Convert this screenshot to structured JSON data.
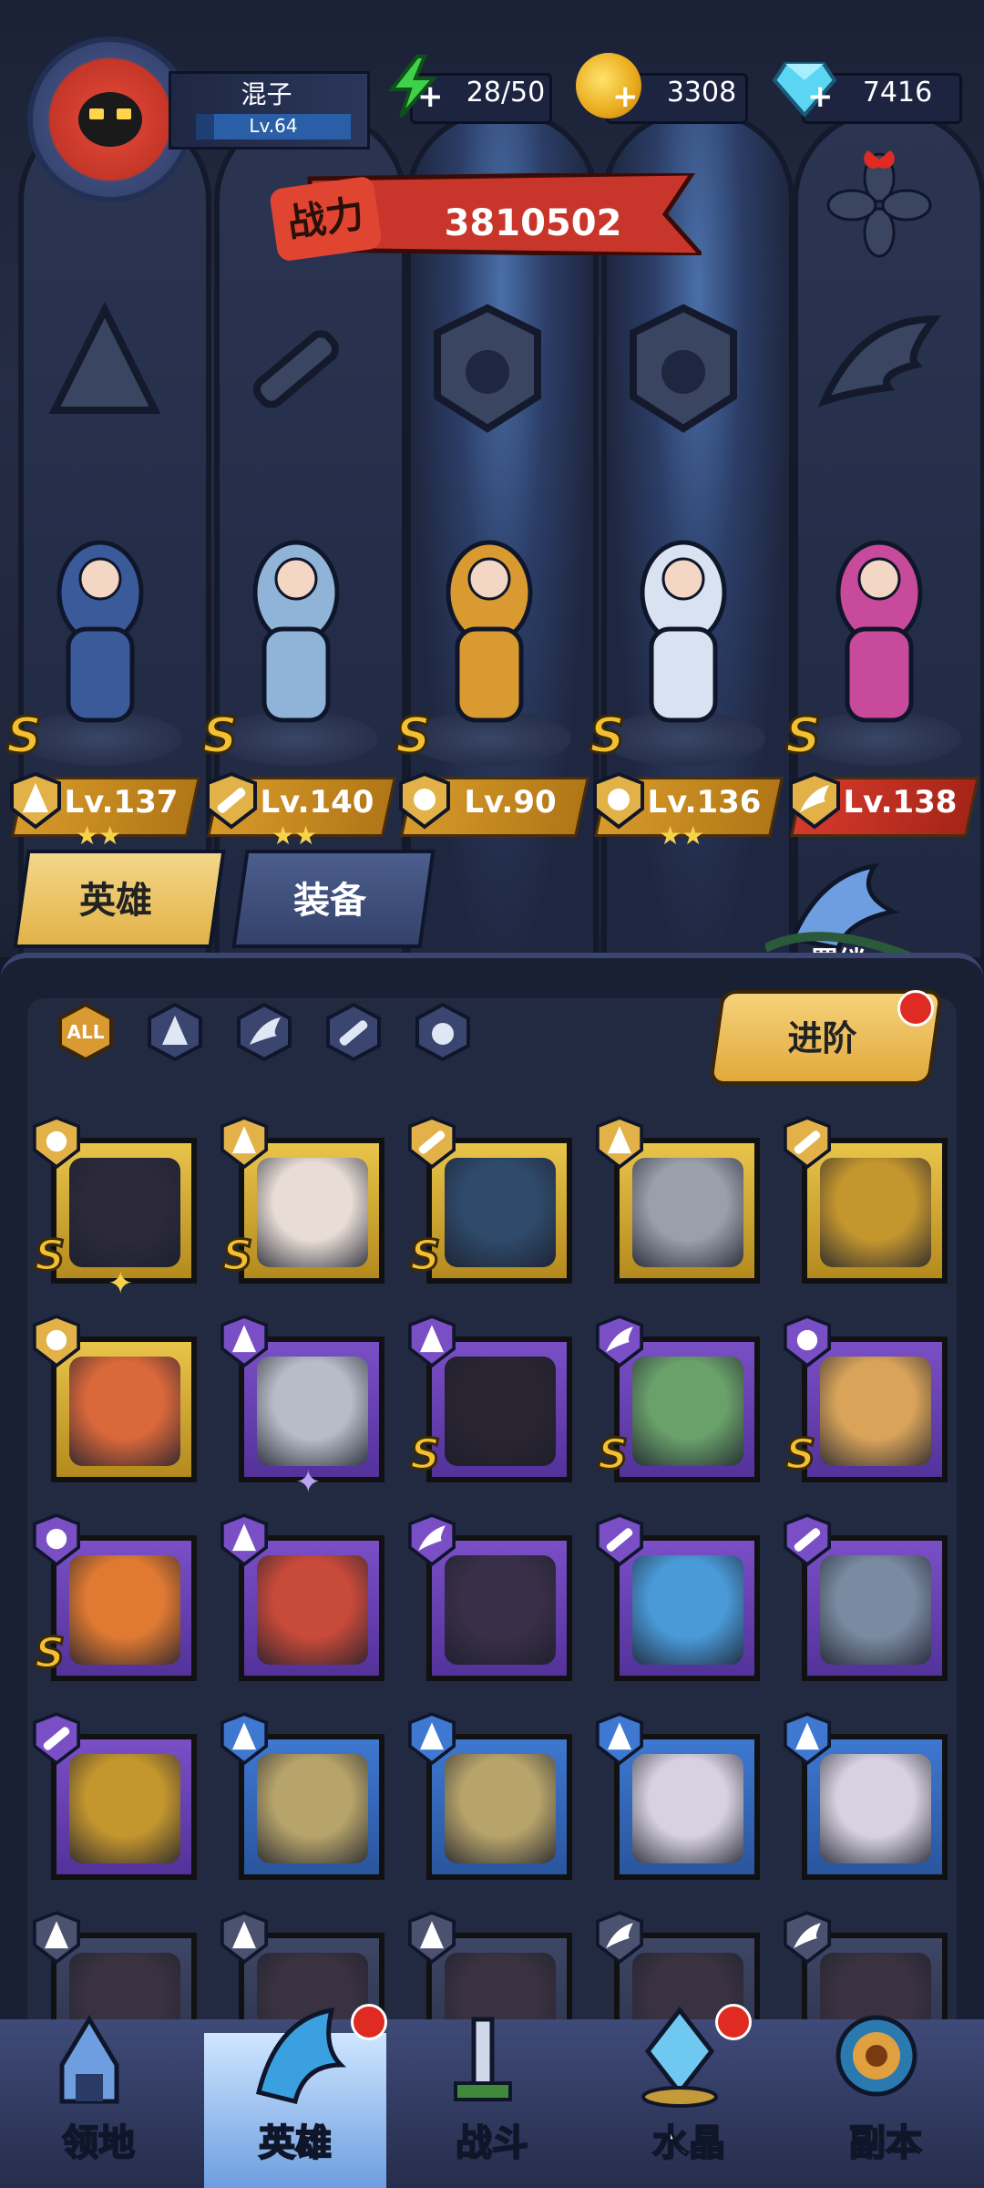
{
  "player": {
    "name": "混子",
    "level": "Lv.64",
    "xp_fraction": 0.12
  },
  "resources": {
    "energy": {
      "icon": "lightning-icon",
      "value": "28/50"
    },
    "gold": {
      "icon": "gold-coin-icon",
      "value": "3308"
    },
    "diamond": {
      "icon": "diamond-icon",
      "value": "7416"
    }
  },
  "power": {
    "label": "战力",
    "value": "3810502"
  },
  "lineup": [
    {
      "name": "card-magician",
      "class": "mage",
      "rank": "S",
      "level": "Lv.137",
      "stars": "★★",
      "plate": "gold"
    },
    {
      "name": "mech-spider",
      "class": "mech",
      "rank": "S",
      "level": "Lv.140",
      "stars": "★★",
      "plate": "gold"
    },
    {
      "name": "cat-shaman",
      "class": "beast",
      "rank": "S",
      "level": "Lv.90",
      "stars": "",
      "plate": "gold"
    },
    {
      "name": "crane-lady",
      "class": "beast",
      "rank": "S",
      "level": "Lv.136",
      "stars": "★★",
      "plate": "gold"
    },
    {
      "name": "succubus",
      "class": "wing",
      "rank": "S",
      "level": "Lv.138",
      "stars": "",
      "plate": "red"
    }
  ],
  "tabs": {
    "heroes": "英雄",
    "equipment": "装备"
  },
  "bond_label": "羁绊",
  "filters": [
    "ALL",
    "mage",
    "wing",
    "mech",
    "beast"
  ],
  "advance_label": "进阶",
  "roster": [
    {
      "frame": "gold",
      "class": "beast",
      "rank": "S",
      "star": "✦",
      "portrait": "#2c2a3a"
    },
    {
      "frame": "gold",
      "class": "mage",
      "rank": "S",
      "star": "",
      "portrait": "#e8ddd6"
    },
    {
      "frame": "gold",
      "class": "mech",
      "rank": "S",
      "star": "",
      "portrait": "#2f4a6a"
    },
    {
      "frame": "gold",
      "class": "mage",
      "rank": "",
      "star": "",
      "portrait": "#9aa0aa"
    },
    {
      "frame": "gold",
      "class": "mech",
      "rank": "",
      "star": "",
      "portrait": "#c4962e"
    },
    {
      "frame": "gold",
      "class": "beast",
      "rank": "",
      "star": "",
      "portrait": "#d9683a"
    },
    {
      "frame": "purple",
      "class": "mage",
      "rank": "",
      "star": "✦",
      "portrait": "#b7bcc6"
    },
    {
      "frame": "purple",
      "class": "mage",
      "rank": "S",
      "star": "",
      "portrait": "#2a2430"
    },
    {
      "frame": "purple",
      "class": "wing",
      "rank": "S",
      "star": "",
      "portrait": "#6aa06a"
    },
    {
      "frame": "purple",
      "class": "beast",
      "rank": "S",
      "star": "",
      "portrait": "#d9a45a"
    },
    {
      "frame": "purple",
      "class": "beast",
      "rank": "S",
      "star": "",
      "portrait": "#e07a32"
    },
    {
      "frame": "purple",
      "class": "mage",
      "rank": "",
      "star": "",
      "portrait": "#c84a3a"
    },
    {
      "frame": "purple",
      "class": "wing",
      "rank": "",
      "star": "",
      "portrait": "#3a2f48"
    },
    {
      "frame": "purple",
      "class": "mech",
      "rank": "",
      "star": "",
      "portrait": "#4a9ad8"
    },
    {
      "frame": "purple",
      "class": "mech",
      "rank": "",
      "star": "",
      "portrait": "#7a8aa0"
    },
    {
      "frame": "purple",
      "class": "mech",
      "rank": "",
      "star": "",
      "portrait": "#c4962e"
    },
    {
      "frame": "blue",
      "class": "mage",
      "rank": "",
      "star": "",
      "portrait": "#b7a46a"
    },
    {
      "frame": "blue",
      "class": "mage",
      "rank": "",
      "star": "",
      "portrait": "#b7a46a"
    },
    {
      "frame": "blue",
      "class": "mage",
      "rank": "",
      "star": "",
      "portrait": "#d8d2e0"
    },
    {
      "frame": "blue",
      "class": "mage",
      "rank": "",
      "star": "",
      "portrait": "#d8d2e0"
    },
    {
      "frame": "grey",
      "class": "mage",
      "rank": "",
      "star": "",
      "portrait": "#3a3240"
    },
    {
      "frame": "grey",
      "class": "mage",
      "rank": "",
      "star": "",
      "portrait": "#3a3240"
    },
    {
      "frame": "grey",
      "class": "mage",
      "rank": "",
      "star": "",
      "portrait": "#3a3240"
    },
    {
      "frame": "grey",
      "class": "wing",
      "rank": "",
      "star": "",
      "portrait": "#3a3240"
    },
    {
      "frame": "grey",
      "class": "wing",
      "rank": "",
      "star": "",
      "portrait": "#3a3240"
    }
  ],
  "nav": [
    {
      "label": "领地",
      "icon": "castle-icon"
    },
    {
      "label": "英雄",
      "icon": "hero-helmet-icon"
    },
    {
      "label": "战斗",
      "icon": "battle-sword-icon"
    },
    {
      "label": "水晶",
      "icon": "crystal-icon"
    },
    {
      "label": "副本",
      "icon": "portal-icon"
    }
  ],
  "colors": {
    "gold": "#e2b248",
    "red": "#d63a2c",
    "panel": "#222a42",
    "accent_blue": "#6e9ee0"
  }
}
